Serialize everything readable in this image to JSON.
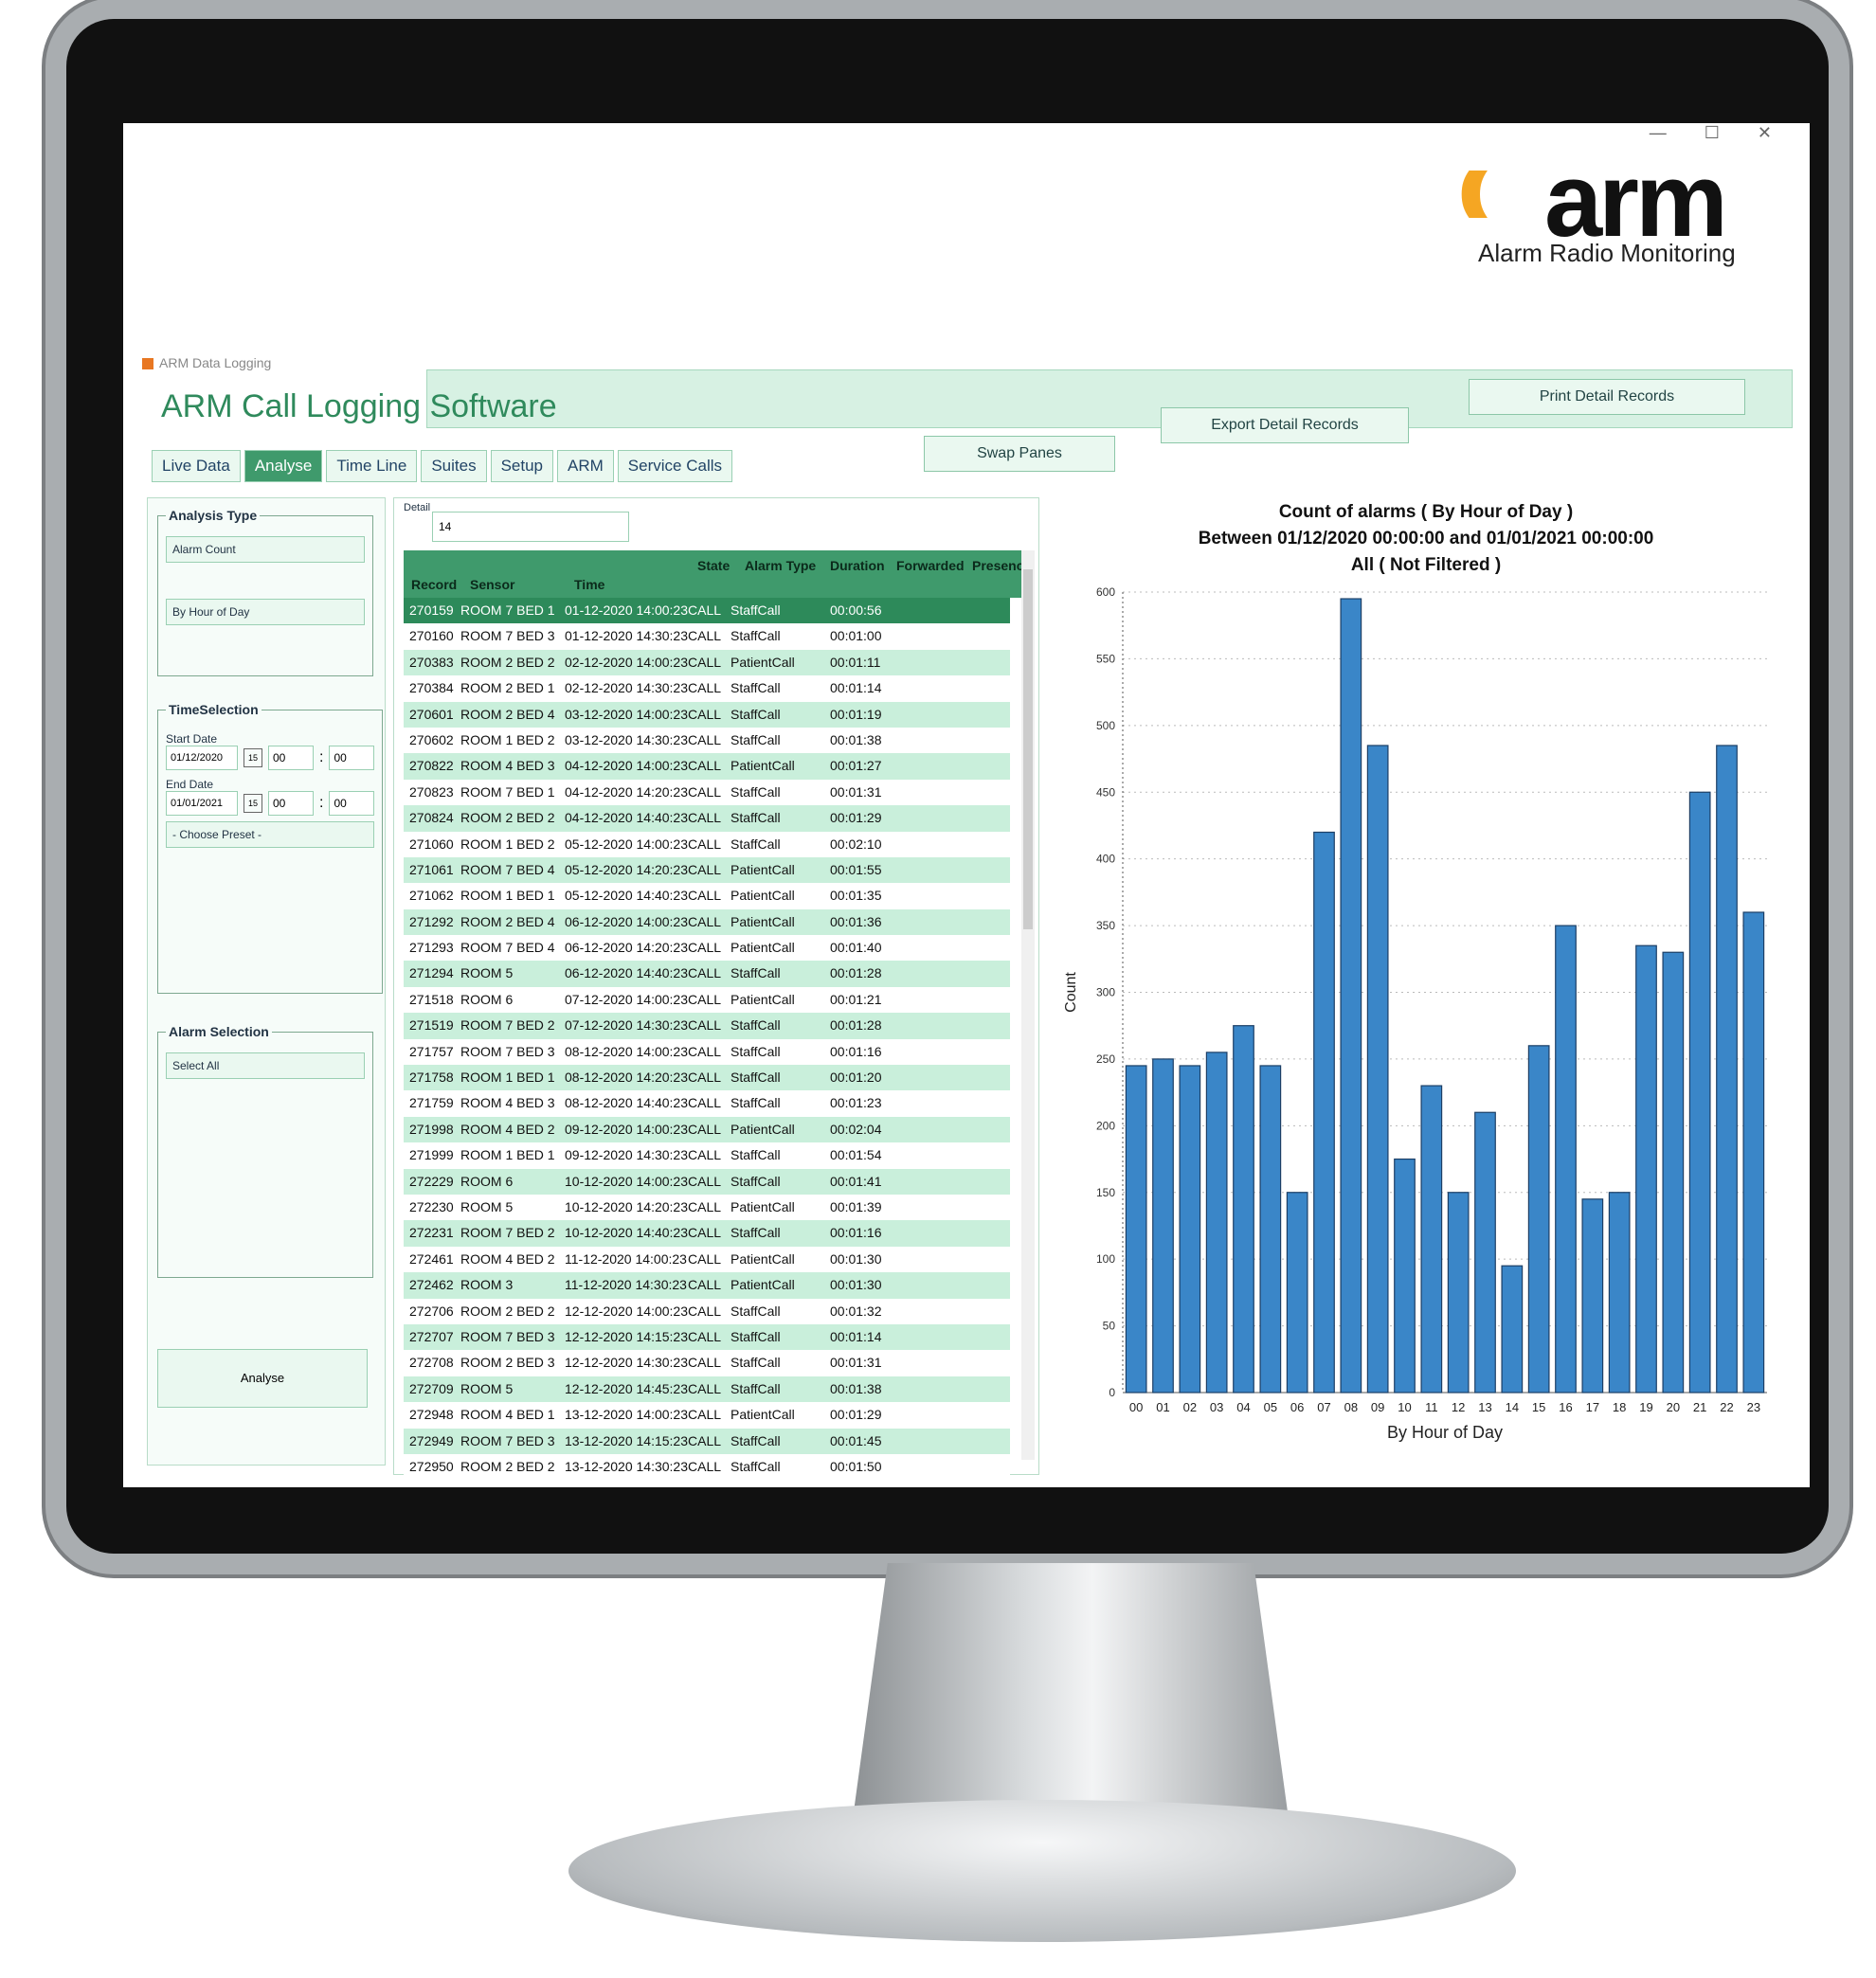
{
  "window": {
    "title": "ARM Data Logging",
    "controls": [
      "—",
      "☐",
      "✕"
    ]
  },
  "logo": {
    "waves": "((((",
    "word": "arm",
    "subtitle": "Alarm Radio Monitoring"
  },
  "app_title": "ARM Call Logging Software",
  "tabs": [
    {
      "label": "Live Data"
    },
    {
      "label": "Analyse",
      "active": true
    },
    {
      "label": "Time Line"
    },
    {
      "label": "Suites"
    },
    {
      "label": "Setup"
    },
    {
      "label": "ARM"
    },
    {
      "label": "Service Calls"
    }
  ],
  "toolbar": {
    "swap": "Swap Panes",
    "export": "Export Detail Records",
    "print": "Print Detail Records"
  },
  "analysis": {
    "legend": "Analysis Type",
    "type": "Alarm Count",
    "grouping": "By Hour of Day"
  },
  "time": {
    "legend": "TimeSelection",
    "start_label": "Start Date",
    "start_date": "01/12/2020",
    "start_h": "00",
    "start_m": "00",
    "end_label": "End Date",
    "end_date": "01/01/2021",
    "end_h": "00",
    "end_m": "00",
    "preset": "- Choose Preset -",
    "cal": "15",
    "sep": ":"
  },
  "alarm": {
    "legend": "Alarm Selection",
    "select": "Select All"
  },
  "analyse_button": "Analyse",
  "detail": {
    "label": "Detail",
    "value": "14"
  },
  "table": {
    "headers": {
      "record": "Record",
      "sensor": "Sensor",
      "time": "Time",
      "state": "State",
      "alarm_type": "Alarm Type",
      "duration": "Duration",
      "forwarded": "Forwarded",
      "presence": "Presence"
    },
    "rows": [
      {
        "record": "270159",
        "sensor": "ROOM 7 BED 1",
        "time": "01-12-2020 14:00:23",
        "state": "CALL",
        "type": "StaffCall",
        "duration": "00:00:56"
      },
      {
        "record": "270160",
        "sensor": "ROOM 7 BED 3",
        "time": "01-12-2020 14:30:23",
        "state": "CALL",
        "type": "StaffCall",
        "duration": "00:01:00"
      },
      {
        "record": "270383",
        "sensor": "ROOM 2 BED 2",
        "time": "02-12-2020 14:00:23",
        "state": "CALL",
        "type": "PatientCall",
        "duration": "00:01:11"
      },
      {
        "record": "270384",
        "sensor": "ROOM 2 BED 1",
        "time": "02-12-2020 14:30:23",
        "state": "CALL",
        "type": "StaffCall",
        "duration": "00:01:14"
      },
      {
        "record": "270601",
        "sensor": "ROOM 2 BED 4",
        "time": "03-12-2020 14:00:23",
        "state": "CALL",
        "type": "StaffCall",
        "duration": "00:01:19"
      },
      {
        "record": "270602",
        "sensor": "ROOM 1 BED 2",
        "time": "03-12-2020 14:30:23",
        "state": "CALL",
        "type": "StaffCall",
        "duration": "00:01:38"
      },
      {
        "record": "270822",
        "sensor": "ROOM 4 BED 3",
        "time": "04-12-2020 14:00:23",
        "state": "CALL",
        "type": "PatientCall",
        "duration": "00:01:27"
      },
      {
        "record": "270823",
        "sensor": "ROOM 7 BED 1",
        "time": "04-12-2020 14:20:23",
        "state": "CALL",
        "type": "StaffCall",
        "duration": "00:01:31"
      },
      {
        "record": "270824",
        "sensor": "ROOM 2 BED 2",
        "time": "04-12-2020 14:40:23",
        "state": "CALL",
        "type": "StaffCall",
        "duration": "00:01:29"
      },
      {
        "record": "271060",
        "sensor": "ROOM 1 BED 2",
        "time": "05-12-2020 14:00:23",
        "state": "CALL",
        "type": "StaffCall",
        "duration": "00:02:10"
      },
      {
        "record": "271061",
        "sensor": "ROOM 7 BED 4",
        "time": "05-12-2020 14:20:23",
        "state": "CALL",
        "type": "PatientCall",
        "duration": "00:01:55"
      },
      {
        "record": "271062",
        "sensor": "ROOM 1 BED 1",
        "time": "05-12-2020 14:40:23",
        "state": "CALL",
        "type": "PatientCall",
        "duration": "00:01:35"
      },
      {
        "record": "271292",
        "sensor": "ROOM 2 BED 4",
        "time": "06-12-2020 14:00:23",
        "state": "CALL",
        "type": "PatientCall",
        "duration": "00:01:36"
      },
      {
        "record": "271293",
        "sensor": "ROOM 7 BED 4",
        "time": "06-12-2020 14:20:23",
        "state": "CALL",
        "type": "PatientCall",
        "duration": "00:01:40"
      },
      {
        "record": "271294",
        "sensor": "ROOM 5",
        "time": "06-12-2020 14:40:23",
        "state": "CALL",
        "type": "StaffCall",
        "duration": "00:01:28"
      },
      {
        "record": "271518",
        "sensor": "ROOM 6",
        "time": "07-12-2020 14:00:23",
        "state": "CALL",
        "type": "PatientCall",
        "duration": "00:01:21"
      },
      {
        "record": "271519",
        "sensor": "ROOM 7 BED 2",
        "time": "07-12-2020 14:30:23",
        "state": "CALL",
        "type": "StaffCall",
        "duration": "00:01:28"
      },
      {
        "record": "271757",
        "sensor": "ROOM 7 BED 3",
        "time": "08-12-2020 14:00:23",
        "state": "CALL",
        "type": "StaffCall",
        "duration": "00:01:16"
      },
      {
        "record": "271758",
        "sensor": "ROOM 1 BED 1",
        "time": "08-12-2020 14:20:23",
        "state": "CALL",
        "type": "StaffCall",
        "duration": "00:01:20"
      },
      {
        "record": "271759",
        "sensor": "ROOM 4 BED 3",
        "time": "08-12-2020 14:40:23",
        "state": "CALL",
        "type": "StaffCall",
        "duration": "00:01:23"
      },
      {
        "record": "271998",
        "sensor": "ROOM 4 BED 2",
        "time": "09-12-2020 14:00:23",
        "state": "CALL",
        "type": "PatientCall",
        "duration": "00:02:04"
      },
      {
        "record": "271999",
        "sensor": "ROOM 1 BED 1",
        "time": "09-12-2020 14:30:23",
        "state": "CALL",
        "type": "StaffCall",
        "duration": "00:01:54"
      },
      {
        "record": "272229",
        "sensor": "ROOM 6",
        "time": "10-12-2020 14:00:23",
        "state": "CALL",
        "type": "StaffCall",
        "duration": "00:01:41"
      },
      {
        "record": "272230",
        "sensor": "ROOM 5",
        "time": "10-12-2020 14:20:23",
        "state": "CALL",
        "type": "PatientCall",
        "duration": "00:01:39"
      },
      {
        "record": "272231",
        "sensor": "ROOM 7 BED 2",
        "time": "10-12-2020 14:40:23",
        "state": "CALL",
        "type": "StaffCall",
        "duration": "00:01:16"
      },
      {
        "record": "272461",
        "sensor": "ROOM 4 BED 2",
        "time": "11-12-2020 14:00:23",
        "state": "CALL",
        "type": "PatientCall",
        "duration": "00:01:30"
      },
      {
        "record": "272462",
        "sensor": "ROOM 3",
        "time": "11-12-2020 14:30:23",
        "state": "CALL",
        "type": "PatientCall",
        "duration": "00:01:30"
      },
      {
        "record": "272706",
        "sensor": "ROOM 2 BED 2",
        "time": "12-12-2020 14:00:23",
        "state": "CALL",
        "type": "StaffCall",
        "duration": "00:01:32"
      },
      {
        "record": "272707",
        "sensor": "ROOM 7 BED 3",
        "time": "12-12-2020 14:15:23",
        "state": "CALL",
        "type": "StaffCall",
        "duration": "00:01:14"
      },
      {
        "record": "272708",
        "sensor": "ROOM 2 BED 3",
        "time": "12-12-2020 14:30:23",
        "state": "CALL",
        "type": "StaffCall",
        "duration": "00:01:31"
      },
      {
        "record": "272709",
        "sensor": "ROOM 5",
        "time": "12-12-2020 14:45:23",
        "state": "CALL",
        "type": "StaffCall",
        "duration": "00:01:38"
      },
      {
        "record": "272948",
        "sensor": "ROOM 4 BED 1",
        "time": "13-12-2020 14:00:23",
        "state": "CALL",
        "type": "PatientCall",
        "duration": "00:01:29"
      },
      {
        "record": "272949",
        "sensor": "ROOM 7 BED 3",
        "time": "13-12-2020 14:15:23",
        "state": "CALL",
        "type": "StaffCall",
        "duration": "00:01:45"
      },
      {
        "record": "272950",
        "sensor": "ROOM 2 BED 2",
        "time": "13-12-2020 14:30:23",
        "state": "CALL",
        "type": "StaffCall",
        "duration": "00:01:50"
      }
    ]
  },
  "chart_data": {
    "type": "bar",
    "title": "Count of alarms ( By Hour of Day )",
    "subtitle": "Between 01/12/2020 00:00:00  and 01/01/2021 00:00:00",
    "subtitle2": "All ( Not Filtered )",
    "xlabel": "By Hour of Day",
    "ylabel": "Count",
    "ylim": [
      0,
      600
    ],
    "yticks": [
      0,
      50,
      100,
      150,
      200,
      250,
      300,
      350,
      400,
      450,
      500,
      550,
      600
    ],
    "categories": [
      "00",
      "01",
      "02",
      "03",
      "04",
      "05",
      "06",
      "07",
      "08",
      "09",
      "10",
      "11",
      "12",
      "13",
      "14",
      "15",
      "16",
      "17",
      "18",
      "19",
      "20",
      "21",
      "22",
      "23"
    ],
    "values": [
      245,
      250,
      245,
      255,
      275,
      245,
      150,
      420,
      595,
      485,
      175,
      230,
      150,
      210,
      95,
      260,
      350,
      145,
      150,
      335,
      330,
      450,
      485,
      360
    ],
    "bar_color": "#3a86c8"
  }
}
